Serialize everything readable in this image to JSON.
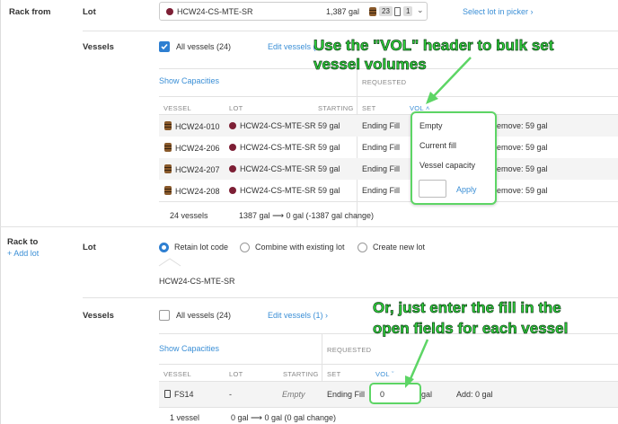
{
  "rack_from": {
    "label": "Rack from",
    "lot_label": "Lot",
    "lot_select": {
      "name": "HCW24-CS-MTE-SR",
      "volume": "1,387 gal",
      "barrels": "23",
      "tanks": "1"
    },
    "select_lot_link": "Select lot in picker",
    "vessels_label": "Vessels",
    "all_vessels": "All vessels (24)",
    "edit_vessels": "Edit vessels (",
    "show_capacities": "Show Capacities",
    "requested_header": "REQUESTED",
    "columns": {
      "vessel": "VESSEL",
      "lot": "LOT",
      "starting": "STARTING",
      "set": "SET",
      "vol": "VOL"
    },
    "rows": [
      {
        "vessel": "HCW24-010",
        "lot": "HCW24-CS-MTE-SR",
        "starting": "59 gal",
        "set": "Ending Fill",
        "change": "emove: 59 gal"
      },
      {
        "vessel": "HCW24-206",
        "lot": "HCW24-CS-MTE-SR",
        "starting": "59 gal",
        "set": "Ending Fill",
        "change": "emove: 59 gal"
      },
      {
        "vessel": "HCW24-207",
        "lot": "HCW24-CS-MTE-SR",
        "starting": "59 gal",
        "set": "Ending Fill",
        "change": "emove: 59 gal"
      },
      {
        "vessel": "HCW24-208",
        "lot": "HCW24-CS-MTE-SR",
        "starting": "59 gal",
        "set": "Ending Fill",
        "change": "emove: 59 gal"
      }
    ],
    "summary_count": "24 vessels",
    "summary_from": "1387 gal",
    "summary_to": "0 gal (-1387 gal change)",
    "vol_menu": {
      "items": [
        "Empty",
        "Current fill",
        "Vessel capacity"
      ],
      "apply": "Apply"
    }
  },
  "rack_to": {
    "label": "Rack to",
    "add_lot": "Add lot",
    "lot_label": "Lot",
    "radio_options": [
      "Retain lot code",
      "Combine with existing lot",
      "Create new lot"
    ],
    "lot_code": "HCW24-CS-MTE-SR",
    "vessels_label": "Vessels",
    "all_vessels": "All vessels (24)",
    "edit_vessels": "Edit vessels (1)",
    "show_capacities": "Show Capacities",
    "requested_header": "REQUESTED",
    "columns": {
      "vessel": "VESSEL",
      "lot": "LOT",
      "starting": "STARTING",
      "set": "SET",
      "vol": "VOL"
    },
    "row": {
      "vessel": "FS14",
      "lot": "-",
      "starting": "Empty",
      "set": "Ending Fill",
      "fill": "0",
      "unit": "gal",
      "change": "Add: 0 gal"
    },
    "summary_count": "1 vessel",
    "summary_from": "0 gal",
    "summary_to": "0 gal (0 gal change)"
  },
  "annotations": {
    "top_line1": "Use the \"VOL\" header to bulk set",
    "top_line2": "vessel volumes",
    "bottom_line1": "Or, just enter the fill in the",
    "bottom_line2": "open fields for each vessel"
  },
  "colors": {
    "accent": "#3b8fd6",
    "callout": "#2fd53c",
    "lot_dot": "#7d1f35"
  }
}
